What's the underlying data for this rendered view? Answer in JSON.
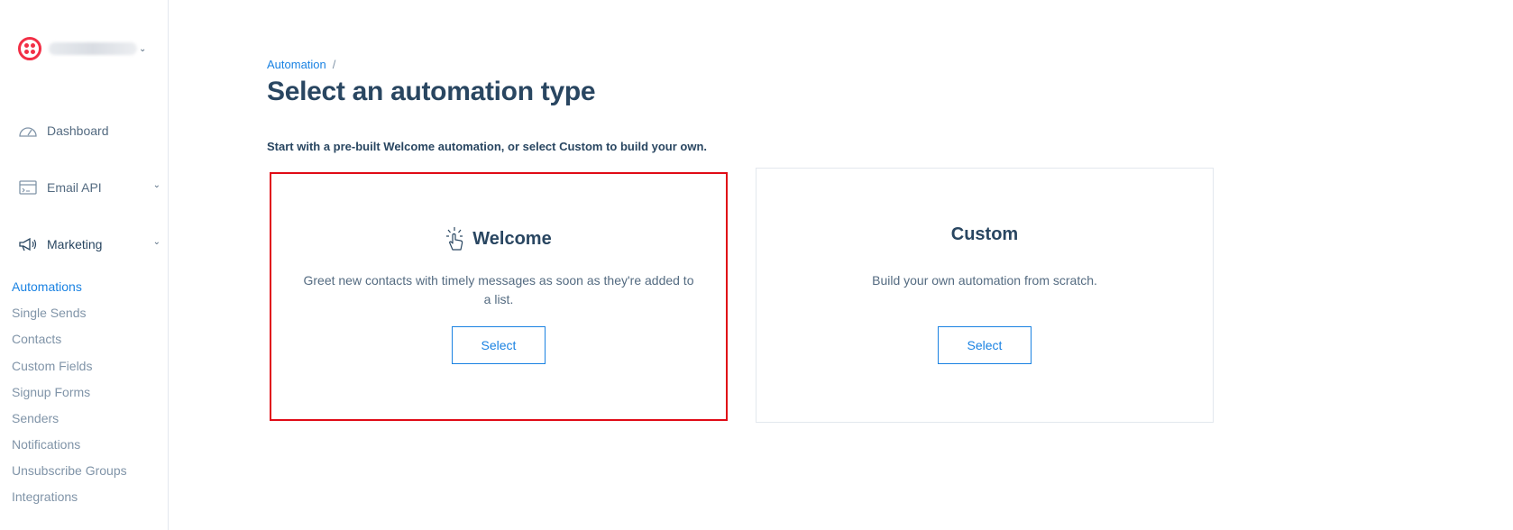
{
  "sidebar": {
    "account": {
      "logo_icon": "twilio-logo-icon",
      "name_blurred": true
    },
    "nav": [
      {
        "label": "Dashboard",
        "icon": "gauge-icon"
      },
      {
        "label": "Email API",
        "icon": "terminal-window-icon",
        "expandable": true
      },
      {
        "label": "Marketing",
        "icon": "megaphone-icon",
        "expandable": true,
        "expanded": true
      }
    ],
    "marketing_items": [
      {
        "label": "Automations",
        "current": true
      },
      {
        "label": "Single Sends"
      },
      {
        "label": "Contacts"
      },
      {
        "label": "Custom Fields"
      },
      {
        "label": "Signup Forms"
      },
      {
        "label": "Senders"
      },
      {
        "label": "Notifications"
      },
      {
        "label": "Unsubscribe Groups"
      },
      {
        "label": "Integrations"
      }
    ]
  },
  "breadcrumb": {
    "link": "Automation",
    "separator": "/"
  },
  "page": {
    "title": "Select an automation type",
    "intro": "Start with a pre-built Welcome automation, or select Custom to build your own."
  },
  "cards": [
    {
      "title": "Welcome",
      "icon": "tap-hand-icon",
      "description": "Greet new contacts with timely messages as soon as they're added to a list.",
      "button": "Select",
      "highlighted": true
    },
    {
      "title": "Custom",
      "description": "Build your own automation from scratch.",
      "button": "Select"
    }
  ],
  "colors": {
    "accent": "#1a82e2",
    "heading": "#294661",
    "muted": "#546b81",
    "highlight_border": "#e00b16",
    "brand": "#f22f46"
  }
}
